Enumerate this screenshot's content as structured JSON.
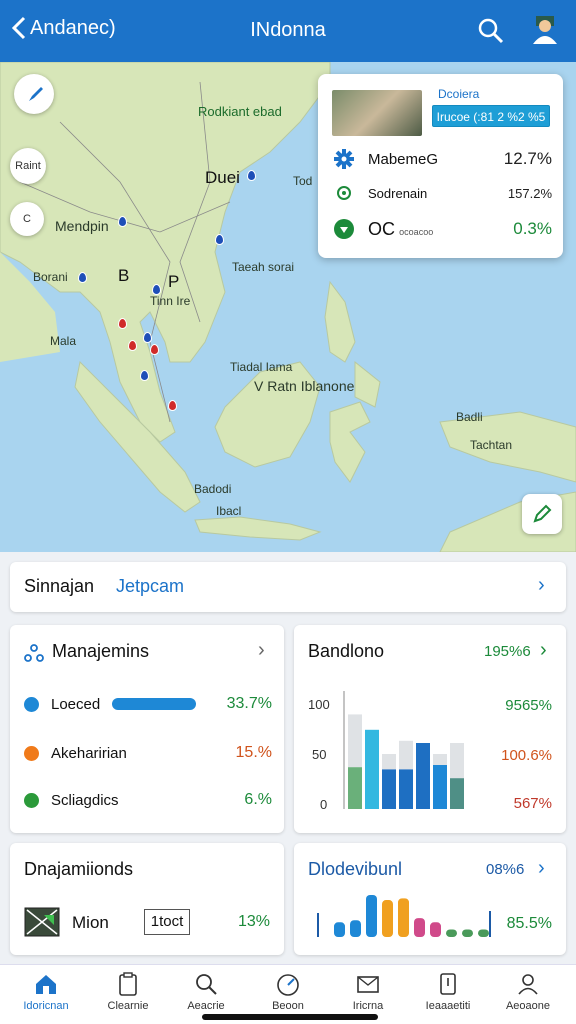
{
  "header": {
    "back_label": "Andanec)",
    "title": "INdonna",
    "icons": [
      "chevron-left-icon",
      "search-icon",
      "profile-icon"
    ]
  },
  "map": {
    "labels": {
      "north": "Rodkiant ebad",
      "city1": "Duei",
      "city1b": "Tod",
      "west": "Mendpin",
      "region": "Borani",
      "bp": "B",
      "bp2": "P",
      "river": "Tinn Ire",
      "small1": "Mala",
      "east_sea": "Taeah sorai",
      "center": "V Ratn Iblanone",
      "sea1": "Tiadal Iama",
      "south1": "Badodi",
      "south2": "Ibacl",
      "se": "Badli",
      "se2": "Tachtan"
    },
    "btn_labels": {
      "top": "Raint",
      "mid": "C"
    },
    "icons": [
      "compass-icon",
      "edit-icon"
    ]
  },
  "overlay": {
    "title": "Dcoiera",
    "badge": "Irucoe (:81 2 %2 %5",
    "rows": [
      {
        "name": "MabemeG",
        "value": "12.7%",
        "icon": "gear-icon",
        "color": "#222222"
      },
      {
        "name": "Sodrenain",
        "value": "157.2%",
        "icon": "target-icon",
        "color": "#222222"
      },
      {
        "name": "OC",
        "name_suffix": "ocoacoo",
        "value": "0.3%",
        "icon": "location-icon",
        "color": "#1c8a3a"
      }
    ]
  },
  "summary_link": {
    "label": "Sinnajan",
    "highlight": "Jetpcam"
  },
  "cards": {
    "management": {
      "title": "Manajemins",
      "items": [
        {
          "label": "Loeced",
          "value": "33.7%",
          "color": "#1e88d6",
          "value_color": "#1c8a3a"
        },
        {
          "label": "Akeharirian",
          "value": "15.%",
          "color": "#f07a1a",
          "value_color": "#d0531c"
        },
        {
          "label": "Scliagdics",
          "value": "6.%",
          "color": "#2b9a3a",
          "value_color": "#1c8a3a"
        }
      ]
    },
    "bandlono": {
      "title": "Bandlono",
      "header_value": "195%6",
      "y_ticks": [
        "100",
        "50",
        "0"
      ],
      "right_values": [
        {
          "value": "9565%",
          "color": "#1c8a3a"
        },
        {
          "value": "100.6%",
          "color": "#d0531c"
        },
        {
          "value": "567%",
          "color": "#c0392b"
        }
      ]
    },
    "dnaja": {
      "title": "Dnajamiionds",
      "item_label": "Mion",
      "item_box": "1toct",
      "value": "13%",
      "icons": [
        "map-thumbnail-icon"
      ]
    },
    "blodevibunt": {
      "title": "Dlodevibunl",
      "header_value": "08%6",
      "value": "85.5%"
    }
  },
  "chart_data": [
    {
      "type": "bar",
      "title": "Bandlono",
      "y_ticks": [
        "100",
        "50",
        "0"
      ],
      "ylim": [
        0,
        100
      ],
      "stacked_bars": [
        {
          "bottom": 38,
          "top": 86,
          "bottom_color": "#6ab07a",
          "top_color": "#dfe2e5"
        },
        {
          "bottom": 72,
          "top": 72,
          "bottom_color": "#33b8e0",
          "top_color": "#33b8e0"
        },
        {
          "bottom": 36,
          "top": 50,
          "bottom_color": "#1e6fc2",
          "top_color": "#dfe2e5"
        },
        {
          "bottom": 36,
          "top": 62,
          "bottom_color": "#1e6fc2",
          "top_color": "#dfe2e5"
        },
        {
          "bottom": 60,
          "top": 60,
          "bottom_color": "#1e6fc2",
          "top_color": "#1e6fc2"
        },
        {
          "bottom": 40,
          "top": 50,
          "bottom_color": "#1e88d6",
          "top_color": "#dfe2e5"
        },
        {
          "bottom": 28,
          "top": 60,
          "bottom_color": "#4f8f86",
          "top_color": "#dfe2e5"
        }
      ]
    },
    {
      "type": "bar",
      "title": "Dlodevibunl",
      "ylim": [
        0,
        100
      ],
      "values": [
        35,
        40,
        100,
        88,
        92,
        45,
        35,
        18,
        18,
        18
      ],
      "colors": [
        "#1e88d6",
        "#1e88d6",
        "#1e88d6",
        "#f0a020",
        "#f0a020",
        "#d04a8a",
        "#d04a8a",
        "#4a9a5a",
        "#4a9a5a",
        "#4a9a5a"
      ]
    }
  ],
  "bottom_nav": [
    {
      "label": "Idoricnan",
      "icon": "home-icon",
      "active": true
    },
    {
      "label": "Clearnie",
      "icon": "clipboard-icon",
      "active": false
    },
    {
      "label": "Aeacrie",
      "icon": "search-icon",
      "active": false
    },
    {
      "label": "Beoon",
      "icon": "gauge-icon",
      "active": false
    },
    {
      "label": "Iricrna",
      "icon": "mail-icon",
      "active": false
    },
    {
      "label": "Ieaaaetiti",
      "icon": "document-icon",
      "active": false
    },
    {
      "label": "Aeoaone",
      "icon": "profile-icon",
      "active": false
    }
  ],
  "colors": {
    "primary": "#1c73c9",
    "water": "#a9d4ef",
    "land": "#d7e6b8"
  }
}
